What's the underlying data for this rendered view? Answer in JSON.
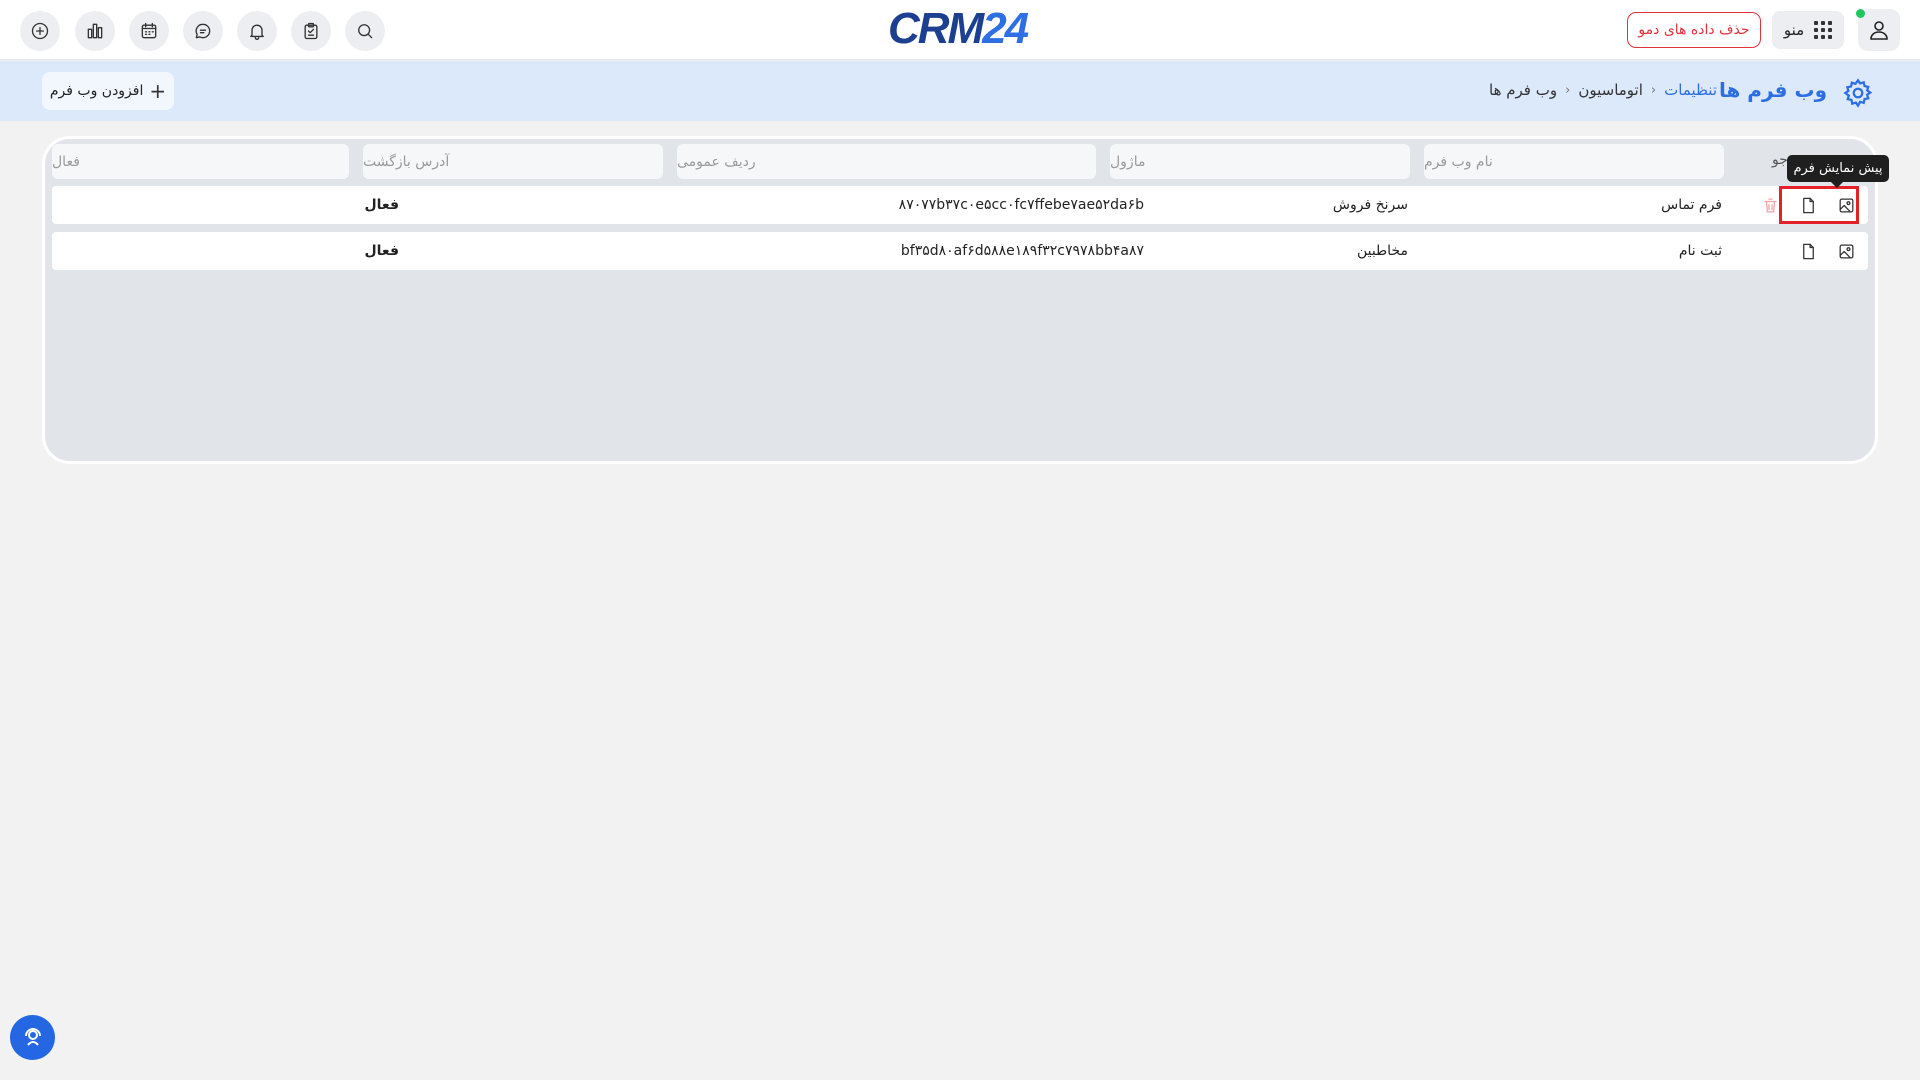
{
  "header": {
    "logo": {
      "crm": "CRM",
      "num": "24"
    },
    "menu_label": "منو",
    "demo_button": "حذف داده های دمو",
    "online_color": "#22c55e",
    "left_icons": [
      "plus-circle-icon",
      "bar-chart-icon",
      "calendar-icon",
      "chat-icon",
      "bell-icon",
      "clipboard-icon",
      "search-icon"
    ]
  },
  "subheader": {
    "title": "وب فرم ها",
    "breadcrumb": {
      "settings": "تنظیمات",
      "automation": "اتوماسیون",
      "current": "وب فرم ها"
    },
    "add_button": "افزودن وب فرم"
  },
  "table": {
    "search_label": "جو",
    "tooltip": "پیش نمایش فرم",
    "filters": {
      "form_name": "نام وب فرم",
      "module": "ماژول",
      "public_id": "ردیف عمومی",
      "return_url": "آدرس بازگشت",
      "active": "فعال"
    },
    "rows": [
      {
        "name": "فرم تماس",
        "module": "سرنخ فروش",
        "id": "۸۷۰۷۷b۳۷c۰e۵cc۰fc۷ffebe۷ae۵۲da۶b",
        "status": "فعال"
      },
      {
        "name": "ثبت نام",
        "module": "مخاطبین",
        "id": "bf۳۵d۸۰af۶d۵۸۸e۱۸۹f۳۲c۷۹۷۸bb۴a۸۷",
        "status": "فعال"
      }
    ]
  },
  "colors": {
    "accent": "#2d6fe3",
    "danger": "#e0343c",
    "highlight": "#e22128"
  }
}
